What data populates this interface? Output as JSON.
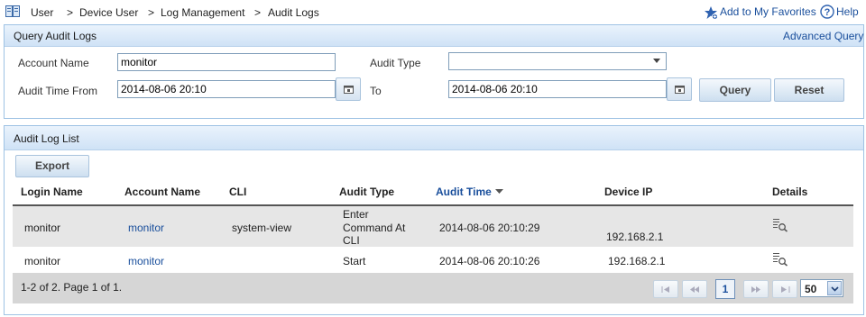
{
  "breadcrumb": {
    "items": [
      "User",
      "Device User",
      "Log Management",
      "Audit Logs"
    ],
    "separator": ">"
  },
  "header_links": {
    "favorites": "Add to My Favorites",
    "help": "Help"
  },
  "query_panel": {
    "title": "Query Audit Logs",
    "advanced_link": "Advanced Query",
    "account_name_label": "Account Name",
    "account_name_value": "monitor",
    "audit_type_label": "Audit Type",
    "audit_type_value": "",
    "audit_time_from_label": "Audit Time From",
    "audit_time_from_value": "2014-08-06 20:10",
    "to_label": "To",
    "to_value": "2014-08-06 20:10",
    "query_button": "Query",
    "reset_button": "Reset"
  },
  "list_panel": {
    "title": "Audit Log List",
    "export_button": "Export",
    "columns": [
      "Login Name",
      "Account Name",
      "CLI",
      "Audit Type",
      "Audit Time",
      "Device IP",
      "Details"
    ],
    "sort_column": "Audit Time",
    "rows": [
      {
        "login_name": "monitor",
        "account_name": "monitor",
        "cli": "system-view",
        "audit_type_lines": [
          "Enter",
          "Command At",
          "CLI"
        ],
        "audit_time": "2014-08-06 20:10:29",
        "device_ip": "192.168.2.1"
      },
      {
        "login_name": "monitor",
        "account_name": "monitor",
        "cli": "",
        "audit_type_lines": [
          "Start"
        ],
        "audit_time": "2014-08-06 20:10:26",
        "device_ip": "192.168.2.1"
      }
    ],
    "pagination": {
      "summary": "1-2 of 2. Page 1 of 1.",
      "current_page": "1",
      "page_size": "50"
    }
  },
  "colors": {
    "panel_border": "#9ec2e4",
    "link": "#1a4f9c",
    "row_shaded": "#e6e6e6",
    "footer": "#d6d6d6"
  }
}
